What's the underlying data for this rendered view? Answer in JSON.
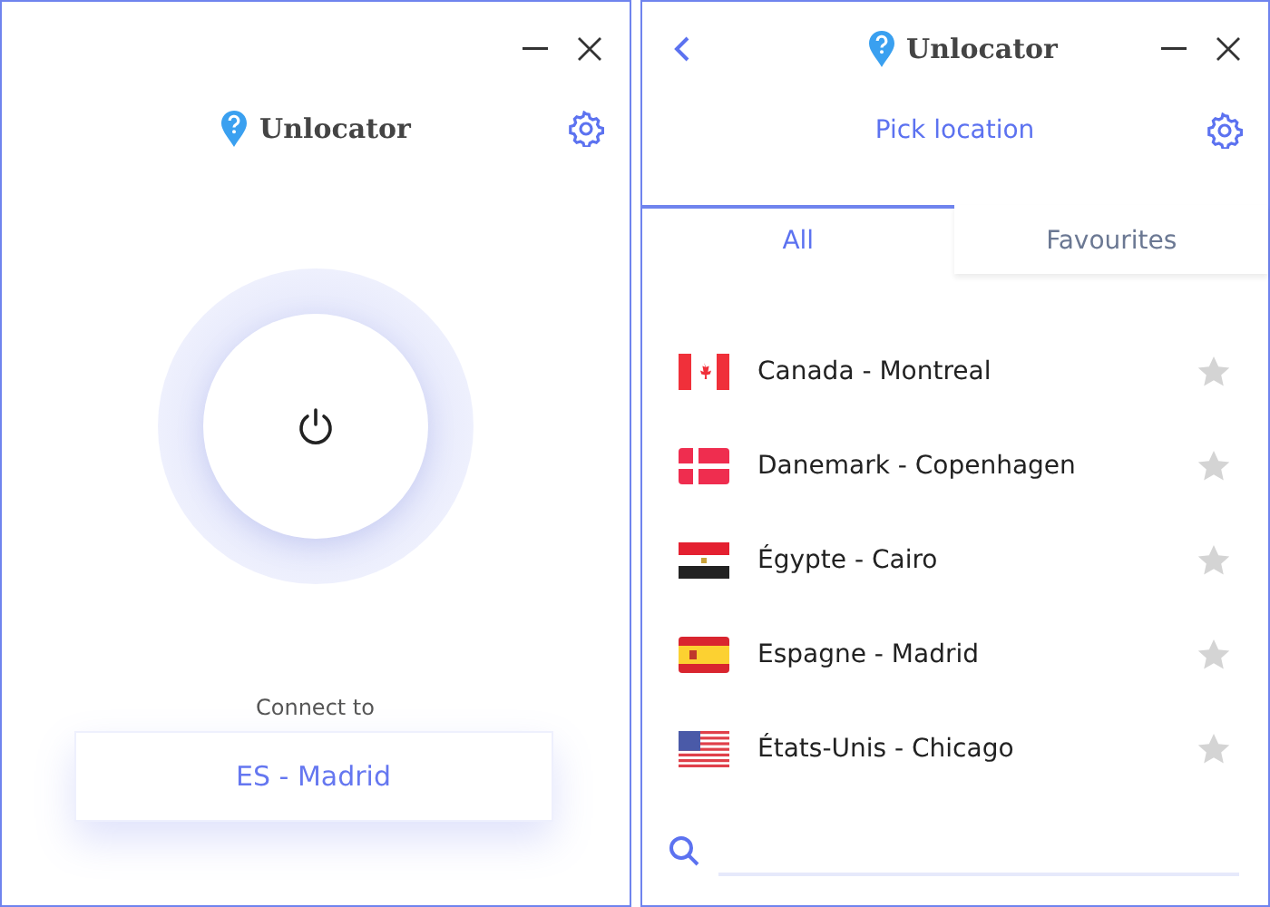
{
  "connect_window": {
    "brand": "Unlocator",
    "connect_label": "Connect to",
    "location": "ES - Madrid"
  },
  "location_window": {
    "brand": "Unlocator",
    "title": "Pick location",
    "tabs": [
      {
        "label": "All",
        "selected": true
      },
      {
        "label": "Favourites",
        "selected": false
      }
    ],
    "locations": [
      {
        "kind": "ca",
        "name": "Canada - Montreal",
        "favourite": false
      },
      {
        "kind": "dk",
        "name": "Danemark - Copenhagen",
        "favourite": false
      },
      {
        "kind": "eg",
        "name": "Égypte - Cairo",
        "favourite": false
      },
      {
        "kind": "es",
        "name": "Espagne - Madrid",
        "favourite": false
      },
      {
        "kind": "us",
        "name": "États-Unis - Chicago",
        "favourite": false
      }
    ]
  }
}
